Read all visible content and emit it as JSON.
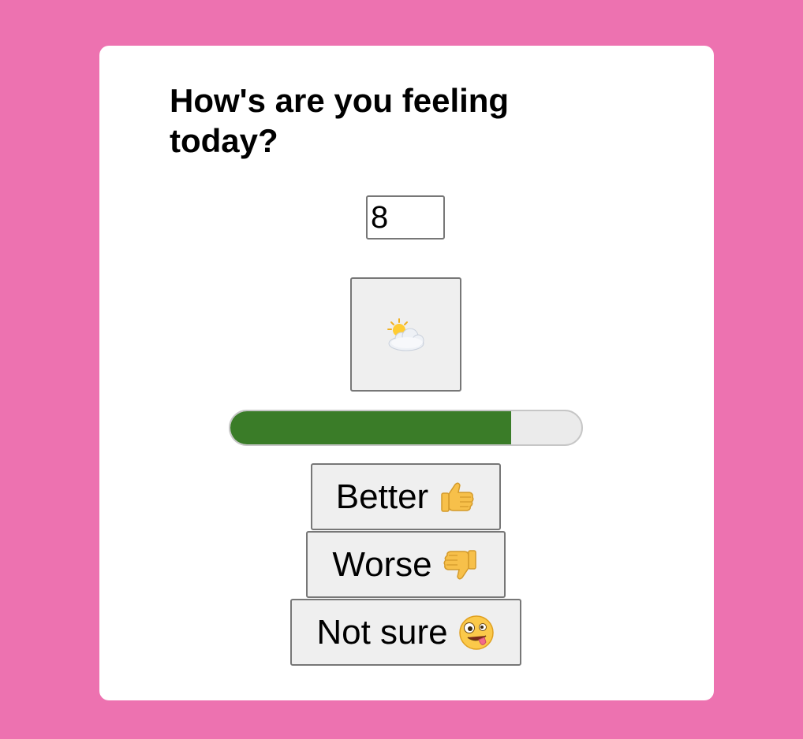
{
  "question": "How's are you feeling today?",
  "mood_input": {
    "value": "8"
  },
  "weather": {
    "icon": "sun-behind-cloud-icon"
  },
  "progress": {
    "fraction": 0.8,
    "fill_color": "#3a7c28",
    "track_color": "#ebebeb"
  },
  "buttons": {
    "better": {
      "label": "Better",
      "icon": "thumbs-up-icon"
    },
    "worse": {
      "label": "Worse",
      "icon": "thumbs-down-icon"
    },
    "not_sure": {
      "label": "Not sure",
      "icon": "zany-face-icon"
    }
  },
  "colors": {
    "page_background": "#ed72b0",
    "card_background": "#ffffff"
  }
}
